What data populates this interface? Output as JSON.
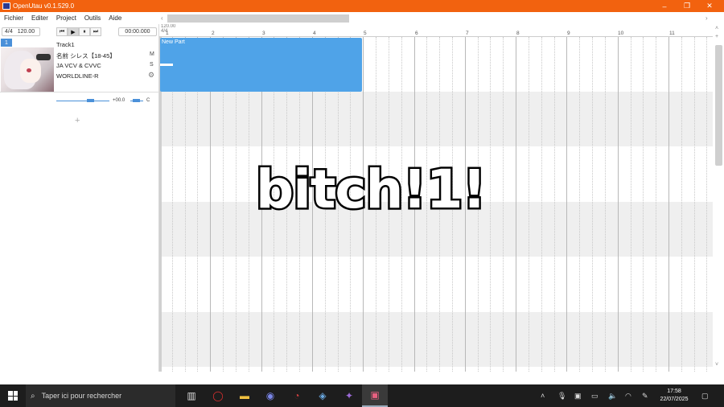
{
  "window": {
    "title": "OpenUtau v0.1.529.0",
    "controls": {
      "minimize": "–",
      "restore": "❐",
      "close": "✕"
    }
  },
  "menu": [
    "Fichier",
    "Editer",
    "Project",
    "Outils",
    "Aide"
  ],
  "transport": {
    "time_signature": "4/4",
    "tempo": "120.00",
    "buttons": {
      "first": "⏮",
      "play": "▶",
      "pause": "⏸",
      "last": "⏭"
    },
    "position": "00:00.000"
  },
  "track": {
    "number": "1",
    "name": "Track1",
    "singer": "名前 シレス【18-45】",
    "phonemizer": "JA VCV & CVVC",
    "renderer": "WORLDLINE-R",
    "mute": "M",
    "solo": "S",
    "volume": "+00.0",
    "pan": "C"
  },
  "add_track": "+",
  "ruler": {
    "tempo_marker": "120.00",
    "timesig_marker": "4/4",
    "bars": [
      "1",
      "2",
      "3",
      "4",
      "5",
      "6",
      "7",
      "8",
      "9",
      "10",
      "11"
    ]
  },
  "part": {
    "name": "New Part"
  },
  "overlay_text": "bitch!1!",
  "taskbar": {
    "search_placeholder": "Taper ici pour rechercher",
    "time": "17:58",
    "date": "22/07/2025"
  },
  "colors": {
    "titlebar": "#f2620f",
    "accent": "#4a90d9",
    "part": "#4fa3e8"
  }
}
